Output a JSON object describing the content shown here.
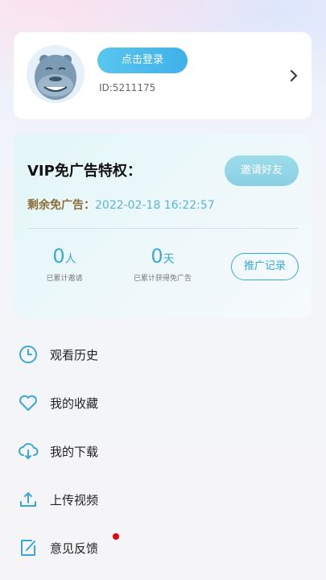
{
  "profile": {
    "login_label": "点击登录",
    "user_id": "ID:5211175"
  },
  "vip": {
    "title": "VIP免广告特权：",
    "invite_label": "邀请好友",
    "remaining_label": "剩余免广告：",
    "remaining_value": "2022-02-18 16:22:57",
    "stats": [
      {
        "value": "0",
        "unit": "人",
        "caption": "已累计邀请"
      },
      {
        "value": "0",
        "unit": "天",
        "caption": "已累计获得免广告"
      }
    ],
    "promo_label": "推广记录"
  },
  "menu": {
    "items": [
      {
        "label": "观看历史",
        "icon": "clock-icon"
      },
      {
        "label": "我的收藏",
        "icon": "heart-icon"
      },
      {
        "label": "我的下载",
        "icon": "cloud-download-icon"
      },
      {
        "label": "上传视频",
        "icon": "upload-icon"
      },
      {
        "label": "意见反馈",
        "icon": "feedback-edit-icon",
        "badge": true
      }
    ]
  },
  "colors": {
    "accent": "#3aa8d6",
    "login_button": "#4dbdee",
    "remaining_label": "#8a6f3b",
    "notification_dot": "#e8000d"
  }
}
